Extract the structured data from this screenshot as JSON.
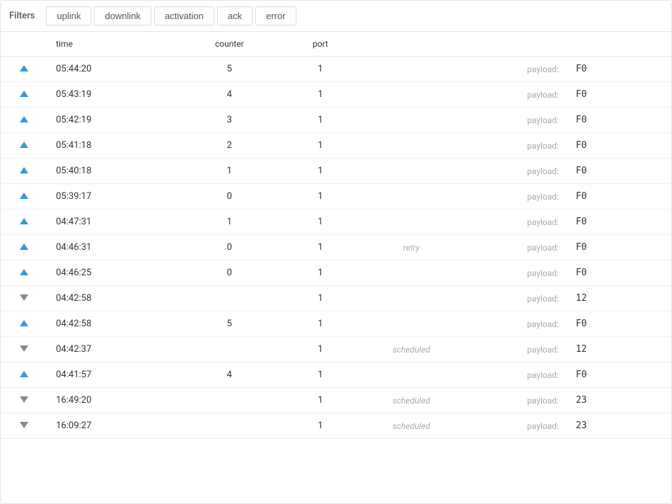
{
  "filters": {
    "label": "Filters",
    "tabs": [
      {
        "id": "uplink",
        "label": "uplink",
        "active": false
      },
      {
        "id": "downlink",
        "label": "downlink",
        "active": false
      },
      {
        "id": "activation",
        "label": "activation",
        "active": false
      },
      {
        "id": "ack",
        "label": "ack",
        "active": false
      },
      {
        "id": "error",
        "label": "error",
        "active": false
      }
    ]
  },
  "table": {
    "columns": {
      "time": "time",
      "counter": "counter",
      "port": "port"
    },
    "rows": [
      {
        "direction": "up",
        "time": "05:44:20",
        "counter": "5",
        "port": "1",
        "tag": "",
        "payload_label": "payload:",
        "payload_value": "F0"
      },
      {
        "direction": "up",
        "time": "05:43:19",
        "counter": "4",
        "port": "1",
        "tag": "",
        "payload_label": "payload:",
        "payload_value": "F0"
      },
      {
        "direction": "up",
        "time": "05:42:19",
        "counter": "3",
        "port": "1",
        "tag": "",
        "payload_label": "payload:",
        "payload_value": "F0"
      },
      {
        "direction": "up",
        "time": "05:41:18",
        "counter": "2",
        "port": "1",
        "tag": "",
        "payload_label": "payload:",
        "payload_value": "F0"
      },
      {
        "direction": "up",
        "time": "05:40:18",
        "counter": "1",
        "port": "1",
        "tag": "",
        "payload_label": "payload:",
        "payload_value": "F0"
      },
      {
        "direction": "up",
        "time": "05:39:17",
        "counter": "0",
        "port": "1",
        "tag": "",
        "payload_label": "payload:",
        "payload_value": "F0"
      },
      {
        "direction": "up",
        "time": "04:47:31",
        "counter": "1",
        "port": "1",
        "tag": "",
        "payload_label": "payload:",
        "payload_value": "F0"
      },
      {
        "direction": "up",
        "time": "04:46:31",
        "counter": "0",
        "port": "1",
        "tag": "retry",
        "payload_label": "payload:",
        "payload_value": "F0"
      },
      {
        "direction": "up",
        "time": "04:46:25",
        "counter": "0",
        "port": "1",
        "tag": "",
        "payload_label": "payload:",
        "payload_value": "F0"
      },
      {
        "direction": "down",
        "time": "04:42:58",
        "counter": "",
        "port": "1",
        "tag": "",
        "payload_label": "payload:",
        "payload_value": "12"
      },
      {
        "direction": "up",
        "time": "04:42:58",
        "counter": "5",
        "port": "1",
        "tag": "",
        "payload_label": "payload:",
        "payload_value": "F0"
      },
      {
        "direction": "down",
        "time": "04:42:37",
        "counter": "",
        "port": "1",
        "tag": "scheduled",
        "payload_label": "payload:",
        "payload_value": "12"
      },
      {
        "direction": "up",
        "time": "04:41:57",
        "counter": "4",
        "port": "1",
        "tag": "",
        "payload_label": "payload:",
        "payload_value": "F0"
      },
      {
        "direction": "down",
        "time": "16:49:20",
        "counter": "",
        "port": "1",
        "tag": "scheduled",
        "payload_label": "payload:",
        "payload_value": "23"
      },
      {
        "direction": "down",
        "time": "16:09:27",
        "counter": "",
        "port": "1",
        "tag": "scheduled",
        "payload_label": "payload:",
        "payload_value": "23"
      }
    ]
  }
}
